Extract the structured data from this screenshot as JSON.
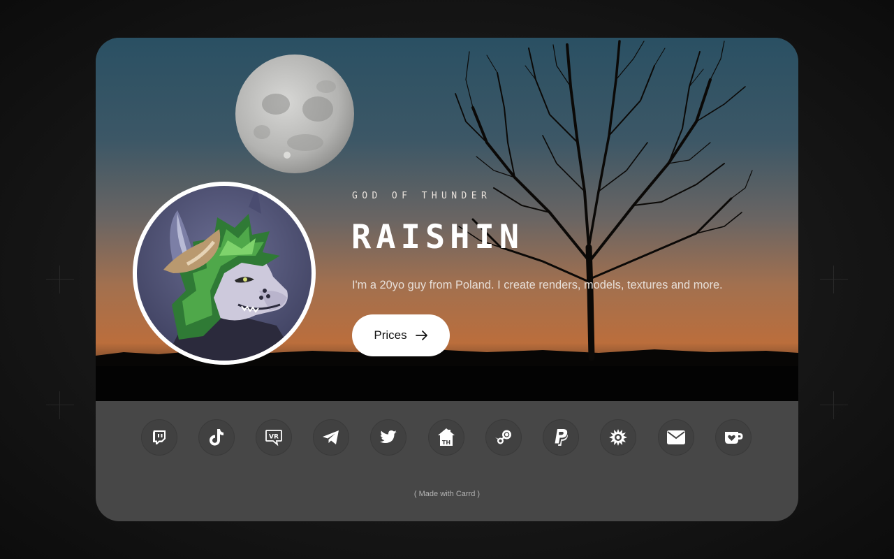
{
  "profile": {
    "tagline": "GOD OF THUNDER",
    "name": "RAISHIN",
    "bio": "I'm a 20yo guy from Poland. I create renders, models, textures and more."
  },
  "cta": {
    "label": "Prices",
    "icon": "arrow-right-icon"
  },
  "social_links": [
    {
      "name": "Twitch",
      "icon": "twitch-icon"
    },
    {
      "name": "TikTok",
      "icon": "tiktok-icon"
    },
    {
      "name": "VRChat",
      "icon": "vrchat-icon"
    },
    {
      "name": "Telegram",
      "icon": "telegram-icon"
    },
    {
      "name": "Twitter",
      "icon": "twitter-icon"
    },
    {
      "name": "Toyhouse",
      "icon": "toyhouse-icon",
      "glyph_text": "TH"
    },
    {
      "name": "Steam",
      "icon": "steam-icon"
    },
    {
      "name": "PayPal",
      "icon": "paypal-icon"
    },
    {
      "name": "Booth",
      "icon": "splat-icon"
    },
    {
      "name": "Email",
      "icon": "mail-icon"
    },
    {
      "name": "Ko-fi",
      "icon": "kofi-icon"
    }
  ],
  "footer": {
    "credit": "( Made with Carrd )"
  },
  "colors": {
    "card_bottom": "#474747",
    "social_button": "#414141",
    "page_background": "#161616",
    "sky_top": "#2c5468",
    "sky_horizon": "#b8714a",
    "button_bg": "#ffffff"
  }
}
